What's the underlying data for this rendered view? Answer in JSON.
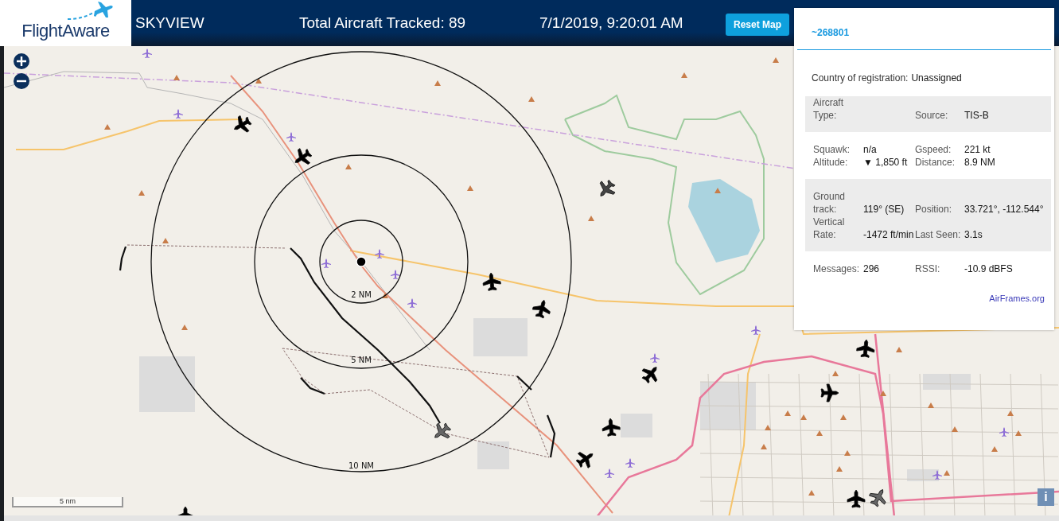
{
  "header": {
    "logo": "FlightAware",
    "title": "SKYVIEW",
    "aircraft_count": "Total Aircraft Tracked: 89",
    "timestamp": "7/1/2019, 9:20:01 AM",
    "reset_button": "Reset Map"
  },
  "map": {
    "range_rings": [
      {
        "label": "2 NM"
      },
      {
        "label": "5 NM"
      },
      {
        "label": "10 NM"
      }
    ],
    "scale": "5 nm",
    "info_button": "i"
  },
  "info_panel": {
    "flight_id": "~268801",
    "country_label": "Country of registration:",
    "country_value": "Unassigned",
    "sections": [
      {
        "shaded": true,
        "rows": [
          {
            "fields": [
              {
                "label": "Aircraft Type:"
              },
              {
                "label": "Source:",
                "value": "TIS-B"
              }
            ]
          }
        ]
      },
      {
        "shaded": false,
        "rows": [
          {
            "fields": [
              {
                "label": "Squawk:",
                "value": "n/a"
              },
              {
                "label": "Gspeed:",
                "value": "221 kt"
              }
            ]
          },
          {
            "fields": [
              {
                "label": "Altitude:",
                "value": "▼ 1,850 ft"
              },
              {
                "label": "Distance:",
                "value": "8.9 NM"
              }
            ]
          }
        ]
      },
      {
        "shaded": true,
        "rows": [
          {
            "fields": [
              {
                "label": "Ground track:",
                "value": "119° (SE)"
              },
              {
                "label": "Position:",
                "value": "33.721°, -112.544°"
              }
            ]
          },
          {
            "fields": [
              {
                "label": "Vertical Rate:",
                "value": "-1472 ft/min"
              },
              {
                "label": "Last Seen:",
                "value": "3.1s"
              }
            ]
          }
        ]
      },
      {
        "shaded": false,
        "rows": [
          {
            "fields": [
              {
                "label": "Messages:",
                "value": "296"
              },
              {
                "label": "RSSI:",
                "value": "-10.9 dBFS"
              }
            ]
          }
        ]
      }
    ],
    "link": "AirFrames.org"
  }
}
